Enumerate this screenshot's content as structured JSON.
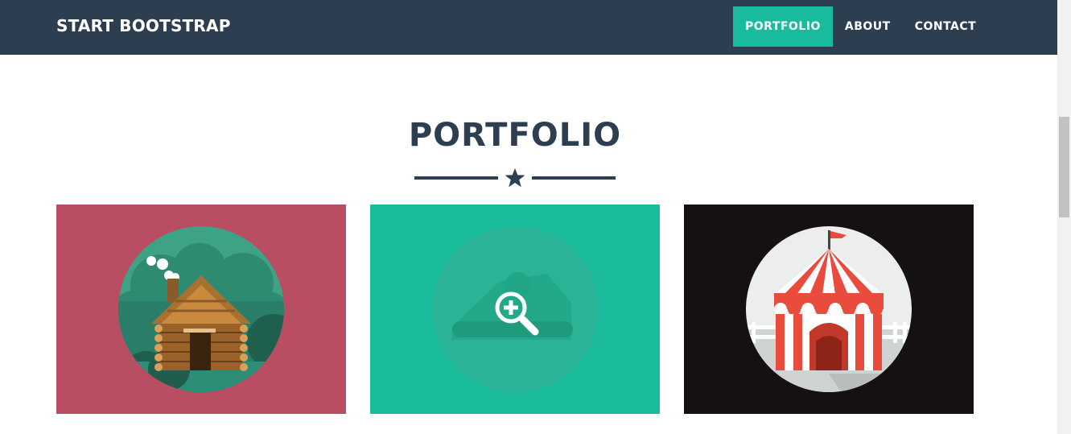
{
  "navbar": {
    "brand": "START BOOTSTRAP",
    "items": [
      {
        "label": "PORTFOLIO",
        "active": true
      },
      {
        "label": "ABOUT",
        "active": false
      },
      {
        "label": "CONTACT",
        "active": false
      }
    ]
  },
  "section": {
    "title": "PORTFOLIO",
    "divider_icon": "star-icon"
  },
  "portfolio": [
    {
      "illustration": "cabin",
      "background": "#b94e63"
    },
    {
      "illustration": "cake",
      "background": "#1abc9c",
      "hover_icon": "zoom-in-icon"
    },
    {
      "illustration": "circus-tent",
      "background": "#151111"
    }
  ],
  "colors": {
    "primary": "#2c3e50",
    "accent": "#18bc9c"
  }
}
